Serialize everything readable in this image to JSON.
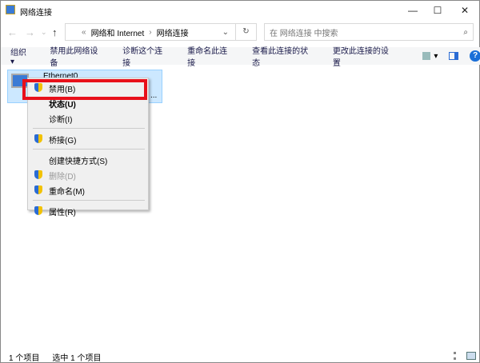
{
  "window": {
    "title": "网络连接",
    "minimize": "—",
    "maximize": "☐",
    "close": "✕"
  },
  "nav": {
    "back": "←",
    "forward": "→",
    "recent": "⌄",
    "up": "↑"
  },
  "address": {
    "prefix": "«",
    "crumbs": [
      "网络和 Internet",
      "›",
      "网络连接"
    ],
    "dropdown": "⌄",
    "refresh": "↻"
  },
  "search": {
    "placeholder": "在 网络连接 中搜索",
    "icon": "⌕"
  },
  "toolbar": {
    "items": [
      "组织 ▾",
      "禁用此网络设备",
      "诊断这个连接",
      "重命名此连接",
      "查看此连接的状态",
      "更改此连接的设置"
    ],
    "view": "▾",
    "help": "?"
  },
  "item": {
    "name": "Ethernet0",
    "ellipsis": "..."
  },
  "menu": [
    {
      "label": "禁用(B)",
      "shield": true
    },
    {
      "label": "状态(U)",
      "bold": true
    },
    {
      "label": "诊断(I)"
    },
    {
      "sep": true
    },
    {
      "label": "桥接(G)",
      "shield": true
    },
    {
      "sep": true
    },
    {
      "label": "创建快捷方式(S)"
    },
    {
      "label": "删除(D)",
      "shield": true,
      "disabled": true
    },
    {
      "label": "重命名(M)",
      "shield": true
    },
    {
      "sep": true
    },
    {
      "label": "属性(R)",
      "shield": true
    }
  ],
  "status": {
    "count": "1 个项目",
    "selected": "选中 1 个项目"
  },
  "colors": {
    "highlight": "#e8101a",
    "selection": "#cce8ff"
  }
}
